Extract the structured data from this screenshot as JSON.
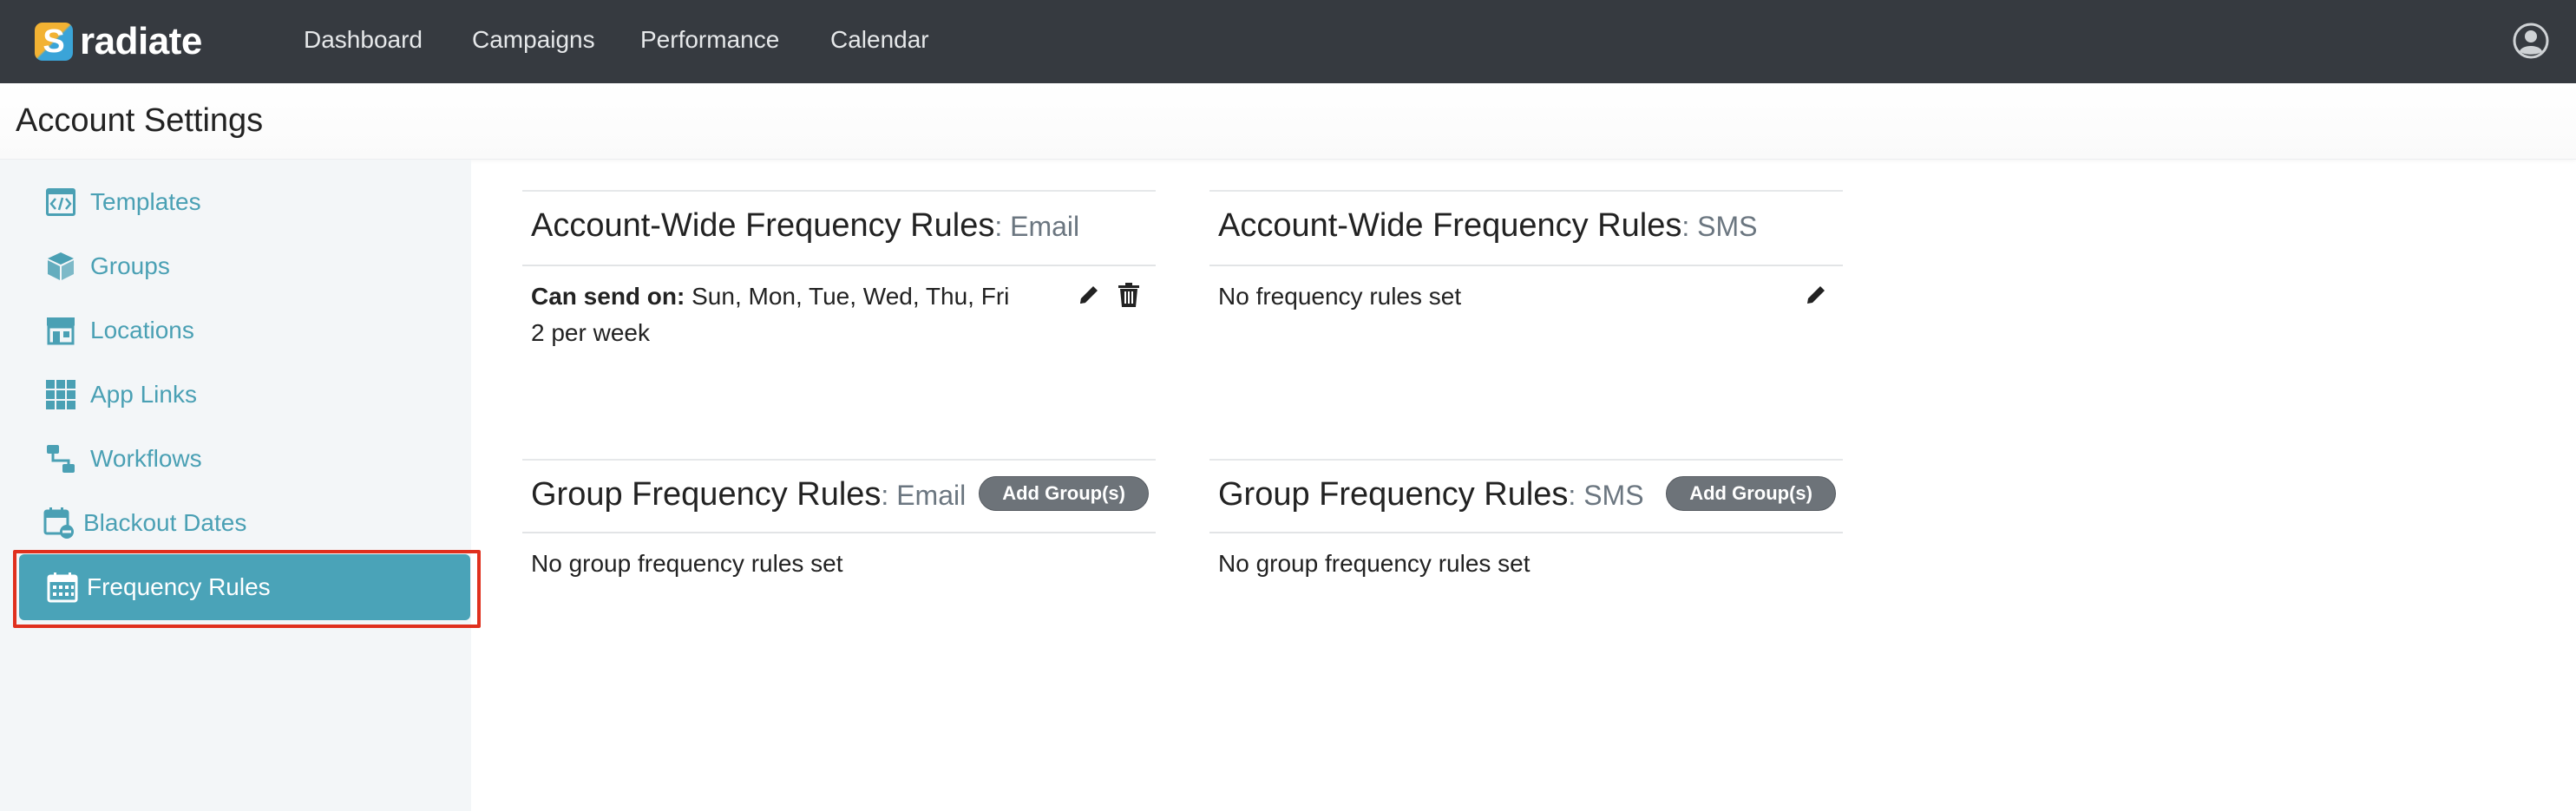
{
  "brand": {
    "name": "radiate",
    "mark_letter": "S",
    "colors": {
      "yellow": "#f2b233",
      "blue": "#3aa4d8"
    }
  },
  "nav": {
    "items": [
      {
        "label": "Dashboard"
      },
      {
        "label": "Campaigns"
      },
      {
        "label": "Performance"
      },
      {
        "label": "Calendar"
      }
    ],
    "user_icon": "user-circle-icon"
  },
  "page": {
    "title": "Account Settings"
  },
  "sidebar": {
    "accent_color": "#4aa3b8",
    "items": [
      {
        "label": "Templates",
        "icon": "code-window-icon"
      },
      {
        "label": "Groups",
        "icon": "cube-icon"
      },
      {
        "label": "Locations",
        "icon": "storefront-icon"
      },
      {
        "label": "App Links",
        "icon": "grid-icon"
      },
      {
        "label": "Workflows",
        "icon": "workflow-icon"
      },
      {
        "label": "Blackout Dates",
        "icon": "calendar-minus-icon"
      },
      {
        "label": "Frequency Rules",
        "icon": "calendar-grid-icon",
        "active": true
      }
    ]
  },
  "panels": {
    "account_email": {
      "title": "Account-Wide Frequency Rules",
      "channel": ": Email",
      "rule_label": "Can send on:",
      "rule_days": " Sun, Mon, Tue, Wed, Thu, Fri",
      "rule_limit": "2 per week",
      "icons": [
        "pencil-icon",
        "trash-icon"
      ]
    },
    "account_sms": {
      "title": "Account-Wide Frequency Rules",
      "channel": ": SMS",
      "empty_text": "No frequency rules set",
      "icons": [
        "pencil-icon"
      ]
    },
    "group_email": {
      "title": "Group Frequency Rules",
      "channel": ": Email",
      "add_label": "Add Group(s)",
      "empty_text": "No group frequency rules set"
    },
    "group_sms": {
      "title": "Group Frequency Rules",
      "channel": ": SMS",
      "add_label": "Add Group(s)",
      "empty_text": "No group frequency rules set"
    }
  }
}
